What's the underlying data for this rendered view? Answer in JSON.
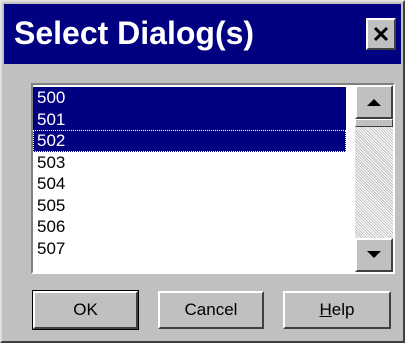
{
  "window": {
    "title": "Select Dialog(s)",
    "close_icon": "close-icon"
  },
  "listbox": {
    "items": [
      {
        "label": "500",
        "selected": true
      },
      {
        "label": "501",
        "selected": true
      },
      {
        "label": "502",
        "selected": true,
        "focused": true
      },
      {
        "label": "503",
        "selected": false
      },
      {
        "label": "504",
        "selected": false
      },
      {
        "label": "505",
        "selected": false
      },
      {
        "label": "506",
        "selected": false
      },
      {
        "label": "507",
        "selected": false
      }
    ],
    "scroll_up_icon": "up-arrow-icon",
    "scroll_down_icon": "down-arrow-icon"
  },
  "buttons": {
    "ok_label": "OK",
    "cancel_label": "Cancel",
    "help_label_underlined": "H",
    "help_label_rest": "elp"
  },
  "colors": {
    "title_bar": "#000080",
    "selection": "#000080",
    "face": "#c0c0c0"
  }
}
